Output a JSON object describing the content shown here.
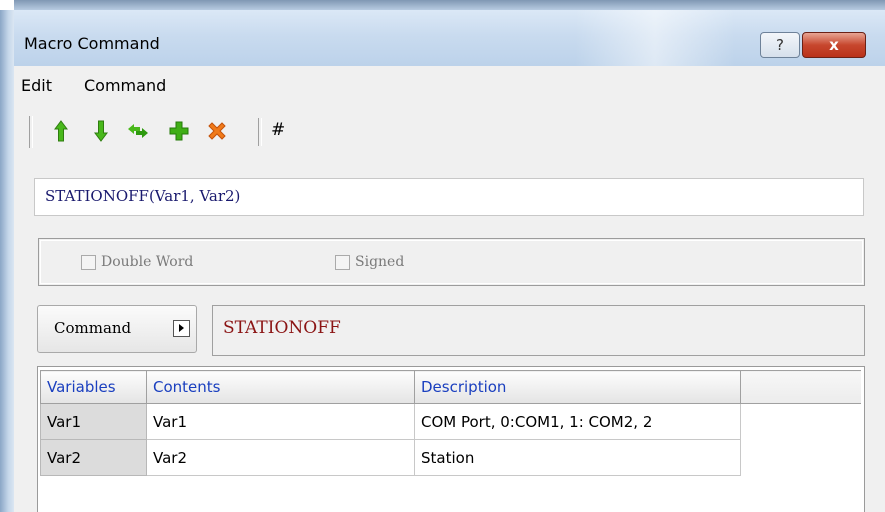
{
  "window": {
    "title": "Macro Command",
    "help_label": "?",
    "close_label": "x"
  },
  "menu": {
    "items": [
      "Edit",
      "Command"
    ]
  },
  "toolbar": {
    "buttons": [
      "move-up-icon",
      "move-down-icon",
      "swap-icon",
      "add-icon",
      "delete-icon"
    ],
    "hash_label": "#"
  },
  "syntax": {
    "text": "STATIONOFF(Var1, Var2)"
  },
  "options": {
    "double_word_label": "Double Word",
    "signed_label": "Signed"
  },
  "command": {
    "button_label": "Command",
    "value": "STATIONOFF"
  },
  "table": {
    "columns": [
      "Variables",
      "Contents",
      "Description"
    ],
    "rows": [
      {
        "variable": "Var1",
        "contents": "Var1",
        "description": "COM Port, 0:COM1, 1: COM2, 2"
      },
      {
        "variable": "Var2",
        "contents": "Var2",
        "description": "Station"
      }
    ]
  },
  "colors": {
    "header_text": "#1a3fbf",
    "command_value": "#8b1414",
    "syntax_text": "#1a1a6e"
  }
}
